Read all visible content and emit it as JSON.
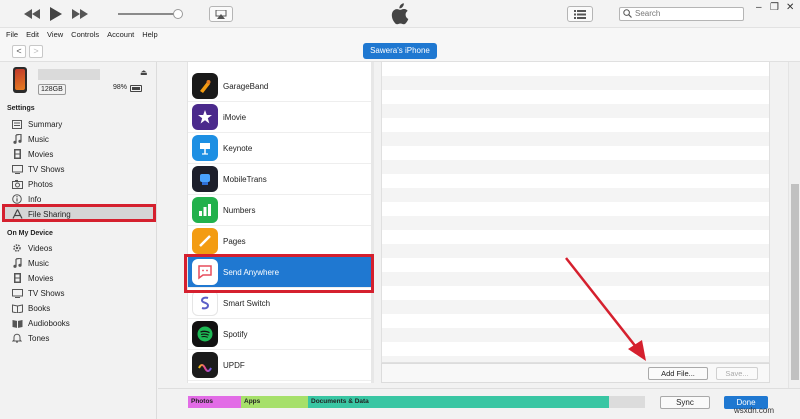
{
  "titlebar": {
    "search_placeholder": "Search",
    "window_controls": [
      "–",
      "❐",
      "✕"
    ],
    "icons": [
      "rewind-icon",
      "play-icon",
      "fast-forward-icon",
      "volume-slider",
      "airplay-icon",
      "apple-logo",
      "list-view-icon",
      "search-icon"
    ]
  },
  "menu": [
    "File",
    "Edit",
    "View",
    "Controls",
    "Account",
    "Help"
  ],
  "navbar": {
    "device_button": "Sawera's iPhone",
    "back": "<",
    "forward": ">"
  },
  "device": {
    "capacity": "128GB",
    "battery": "98%",
    "eject": "⏏"
  },
  "sidebar": {
    "settings_header": "Settings",
    "settings_items": [
      {
        "label": "Summary",
        "icon": "summary-icon"
      },
      {
        "label": "Music",
        "icon": "music-icon"
      },
      {
        "label": "Movies",
        "icon": "movies-icon"
      },
      {
        "label": "TV Shows",
        "icon": "tv-icon"
      },
      {
        "label": "Photos",
        "icon": "photos-icon"
      },
      {
        "label": "Info",
        "icon": "info-icon"
      },
      {
        "label": "File Sharing",
        "icon": "apps-icon",
        "selected": true
      }
    ],
    "device_header": "On My Device",
    "device_items": [
      {
        "label": "Videos",
        "icon": "videos-icon"
      },
      {
        "label": "Music",
        "icon": "music-icon"
      },
      {
        "label": "Movies",
        "icon": "movies-icon"
      },
      {
        "label": "TV Shows",
        "icon": "tv-icon"
      },
      {
        "label": "Books",
        "icon": "books-icon"
      },
      {
        "label": "Audiobooks",
        "icon": "audiobooks-icon"
      },
      {
        "label": "Tones",
        "icon": "bell-icon"
      }
    ]
  },
  "apps": [
    {
      "name": "GarageBand",
      "color": "#1a1a1a"
    },
    {
      "name": "iMovie",
      "color": "#4b2a8c"
    },
    {
      "name": "Keynote",
      "color": "#1d8fe3"
    },
    {
      "name": "MobileTrans",
      "color": "#1d1f2b"
    },
    {
      "name": "Numbers",
      "color": "#22b14c"
    },
    {
      "name": "Pages",
      "color": "#f39c12"
    },
    {
      "name": "Send Anywhere",
      "color": "#ffffff",
      "selected": true
    },
    {
      "name": "Smart Switch",
      "color": "#ffffff"
    },
    {
      "name": "Spotify",
      "color": "#111111"
    },
    {
      "name": "UPDF",
      "color": "#1b1b1b"
    }
  ],
  "docs_footer": {
    "add_file": "Add File...",
    "save": "Save..."
  },
  "storage": [
    {
      "label": "Photos",
      "color": "#e26ce6"
    },
    {
      "label": "Apps",
      "color": "#a6e06a"
    },
    {
      "label": "Documents & Data",
      "color": "#39c6a3"
    },
    {
      "label": "",
      "color": "#dcdcdc"
    }
  ],
  "bottom": {
    "sync": "Sync",
    "done": "Done"
  },
  "watermark": "wsxdn.com",
  "accent_color": "#1f78d1",
  "highlight_color": "#d5202e"
}
